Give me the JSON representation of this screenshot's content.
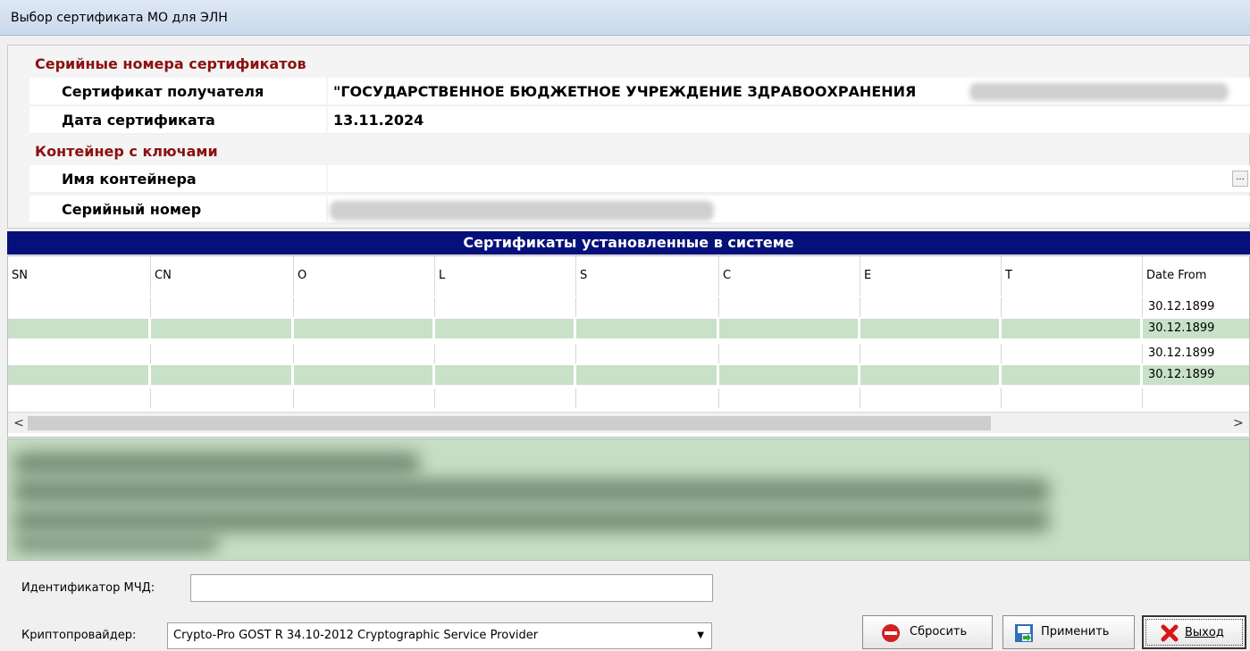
{
  "window": {
    "title": "Выбор сертификата МО для ЭЛН"
  },
  "serials": {
    "category": "Серийные номера сертификатов",
    "recipient_label": "Сертификат получателя",
    "recipient_value": "\"ГОСУДАРСТВЕННОЕ БЮДЖЕТНОЕ УЧРЕЖДЕНИЕ ЗДРАВООХРАНЕНИЯ",
    "date_label": "Дата сертификата",
    "date_value": "13.11.2024"
  },
  "container": {
    "category": "Контейнер с ключами",
    "name_label": "Имя контейнера",
    "name_value": "",
    "browse_label": "...",
    "serial_label": "Серийный номер"
  },
  "cert_grid": {
    "caption": "Сертификаты установленные в системе",
    "columns": [
      "SN",
      "CN",
      "O",
      "L",
      "S",
      "C",
      "E",
      "T",
      "Date From"
    ],
    "rows": [
      {
        "date_from": "30.12.1899"
      },
      {
        "date_from": "30.12.1899"
      },
      {
        "date_from": "30.12.1899"
      },
      {
        "date_from": "30.12.1899"
      }
    ],
    "scroll_left_icon": "chevron-left-icon",
    "scroll_right_icon": "chevron-right-icon"
  },
  "mchd": {
    "label": "Идентификатор МЧД:",
    "value": ""
  },
  "crypto": {
    "label": "Криптопровайдер:",
    "selected": "Crypto-Pro GOST R 34.10-2012 Cryptographic Service Provider"
  },
  "buttons": {
    "reset": "Сбросить",
    "apply": "Применить",
    "exit": "Выход"
  },
  "colors": {
    "category_text": "#8b1010",
    "grid_caption_bg": "#06107a",
    "row_alt_bg": "#c9e0c9",
    "info_bg": "#c6ddc6"
  }
}
